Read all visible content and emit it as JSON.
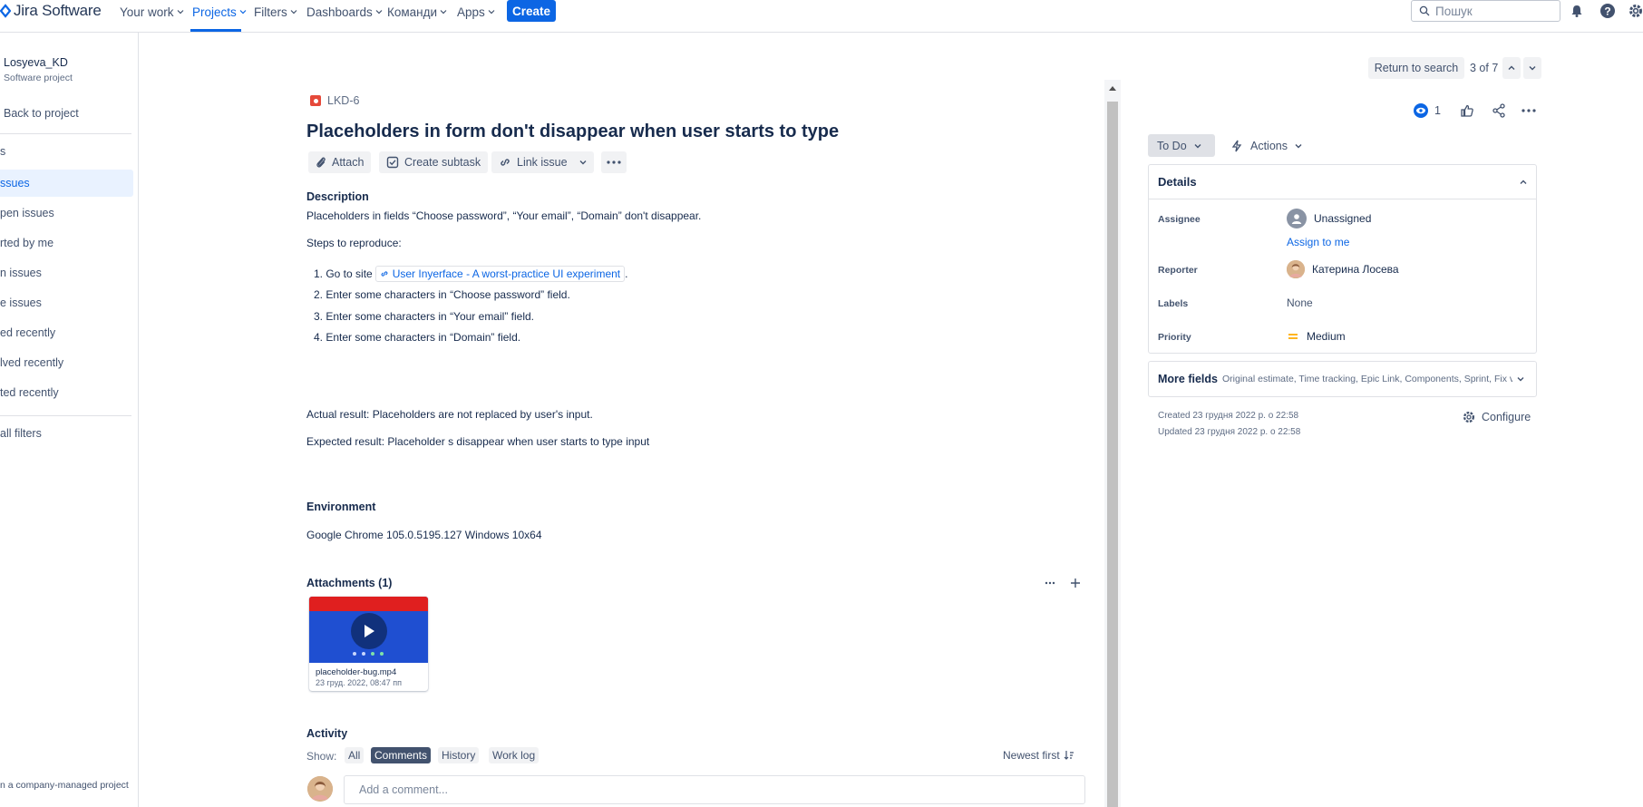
{
  "topnav": {
    "logo": "Jira Software",
    "items": [
      "Your work",
      "Projects",
      "Filters",
      "Dashboards",
      "Команди",
      "Apps"
    ],
    "create_label": "Create",
    "search_placeholder": "Пошук",
    "icons": [
      "bell-icon",
      "help-icon",
      "settings-icon"
    ]
  },
  "sidebar": {
    "project_name": "Losyeva_KD",
    "project_type": "Software project",
    "back": "Back to project",
    "section": "s",
    "items": [
      "ssues",
      "pen issues",
      "rted by me",
      "n issues",
      "e issues",
      "ed recently",
      "lved recently",
      "ted recently"
    ],
    "view_filters": "all filters",
    "footer": "n a company-managed project"
  },
  "issue": {
    "key": "LKD-6",
    "summary": "Placeholders in form don't disappear when user starts to type",
    "toolbar": {
      "attach": "Attach",
      "subtask": "Create subtask",
      "link": "Link issue"
    },
    "description_label": "Description",
    "description_line": "Placeholders in fields “Choose password”, “Your email”, “Domain” don't disappear.",
    "steps_label": "Steps to reproduce:",
    "steps": {
      "step1_prefix": "1. Go to site",
      "step1_link": "User Inyerface - A worst-practice UI experiment",
      "step1_suffix": ".",
      "step2": "2. Enter some characters in “Choose password” field.",
      "step3": "3. Enter some characters in “Your email” field.",
      "step4": "4. Enter some characters in “Domain” field."
    },
    "actual": "Actual result: Placeholders are not replaced by user's input.",
    "expected": "Expected result: Placeholder s disappear when user starts to type input",
    "environment_label": "Environment",
    "environment": "Google Chrome 105.0.5195.127 Windows 10x64",
    "attachments_label": "Attachments (1)",
    "attachment": {
      "name": "placeholder-bug.mp4",
      "date": "23 груд. 2022, 08:47 пп"
    },
    "activity": {
      "label": "Activity",
      "show": "Show:",
      "tabs": [
        "All",
        "Comments",
        "History",
        "Work log"
      ],
      "active_tab": "Comments",
      "sort": "Newest first",
      "comment_placeholder": "Add a comment..."
    }
  },
  "right": {
    "return_label": "Return to search",
    "counter": "3 of 7",
    "watchers": "1",
    "status": "To Do",
    "actions": "Actions",
    "details_title": "Details",
    "fields": {
      "assignee_label": "Assignee",
      "assignee": "Unassigned",
      "assign_to_me": "Assign to me",
      "reporter_label": "Reporter",
      "reporter": "Катерина Лосева",
      "labels_label": "Labels",
      "labels": "None",
      "priority_label": "Priority",
      "priority": "Medium"
    },
    "more_fields_title": "More fields",
    "more_fields_sub": "Original estimate, Time tracking, Epic Link, Components, Sprint, Fix ver...",
    "created": "Created 23 грудня 2022 р. о 22:58",
    "updated": "Updated 23 грудня 2022 р. о 22:58",
    "configure": "Configure"
  },
  "colors": {
    "brand": "#0c66e4",
    "bug": "#e5493a",
    "priority_medium": "#ffab00"
  }
}
